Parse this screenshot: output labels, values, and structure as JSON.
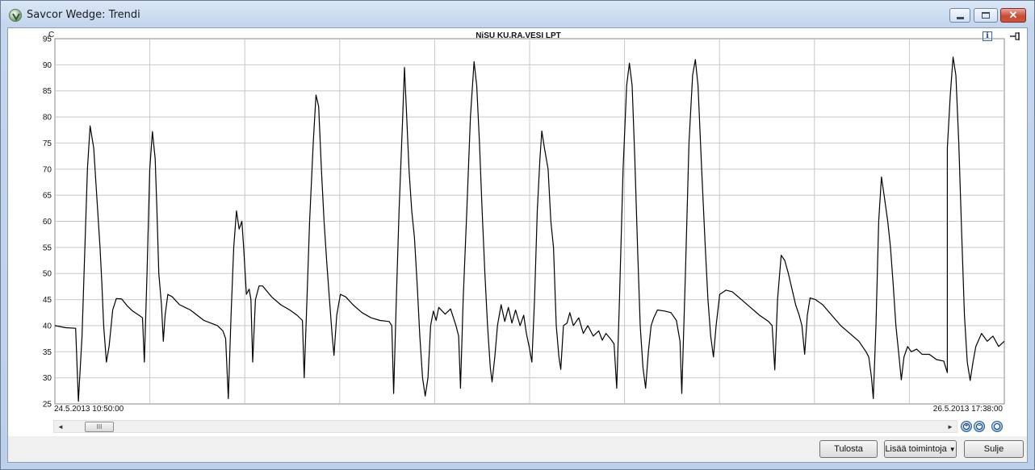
{
  "window": {
    "title": "Savcor Wedge: Trendi",
    "controls": {
      "minimize_icon": "minimize-icon",
      "maximize_icon": "maximize-icon",
      "close_icon": "close-icon"
    }
  },
  "chart_data": {
    "type": "line",
    "title": "NiSU KU.RA.VESI LPT",
    "ylabel": "C",
    "ylim": [
      25,
      95
    ],
    "yticks": [
      25,
      30,
      35,
      40,
      45,
      50,
      55,
      60,
      65,
      70,
      75,
      80,
      85,
      90,
      95
    ],
    "xlim": [
      0,
      100
    ],
    "grid": true,
    "x_start_label": "24.5.2013 10:50:00",
    "x_end_label": "26.5.2013 17:38:00",
    "series": [
      {
        "color": "#000000",
        "points": [
          [
            0,
            40
          ],
          [
            1.2,
            39.6
          ],
          [
            2.3,
            39.5
          ],
          [
            2.6,
            25.5
          ],
          [
            3,
            38
          ],
          [
            3.6,
            70
          ],
          [
            3.9,
            78.3
          ],
          [
            4.3,
            74
          ],
          [
            4.7,
            63
          ],
          [
            5,
            55
          ],
          [
            5.2,
            48
          ],
          [
            5.4,
            40
          ],
          [
            5.7,
            33
          ],
          [
            6,
            36
          ],
          [
            6.4,
            43
          ],
          [
            6.8,
            45.2
          ],
          [
            7.4,
            45.1
          ],
          [
            8,
            43.8
          ],
          [
            8.6,
            42.8
          ],
          [
            9.3,
            42
          ],
          [
            9.7,
            41.5
          ],
          [
            9.9,
            33
          ],
          [
            10.2,
            50
          ],
          [
            10.5,
            70
          ],
          [
            10.8,
            77.2
          ],
          [
            11.1,
            72
          ],
          [
            11.3,
            62
          ],
          [
            11.5,
            50
          ],
          [
            11.8,
            44
          ],
          [
            12,
            37
          ],
          [
            12.2,
            42
          ],
          [
            12.5,
            46
          ],
          [
            13,
            45.5
          ],
          [
            13.8,
            44
          ],
          [
            15,
            43
          ],
          [
            16.5,
            41
          ],
          [
            18,
            40
          ],
          [
            18.6,
            39
          ],
          [
            18.9,
            37.5
          ],
          [
            19.2,
            26
          ],
          [
            19.5,
            42
          ],
          [
            19.8,
            55
          ],
          [
            20.1,
            62
          ],
          [
            20.4,
            58.5
          ],
          [
            20.7,
            60
          ],
          [
            20.9,
            55
          ],
          [
            21.2,
            46
          ],
          [
            21.5,
            47
          ],
          [
            21.7,
            45
          ],
          [
            21.9,
            33
          ],
          [
            22.2,
            45
          ],
          [
            22.6,
            47.6
          ],
          [
            23,
            47.6
          ],
          [
            24,
            45.5
          ],
          [
            25,
            44
          ],
          [
            26,
            43
          ],
          [
            26.8,
            42
          ],
          [
            27.4,
            41
          ],
          [
            27.6,
            30
          ],
          [
            27.9,
            45
          ],
          [
            28.2,
            60
          ],
          [
            28.6,
            75
          ],
          [
            28.9,
            84.2
          ],
          [
            29.2,
            82
          ],
          [
            29.5,
            70
          ],
          [
            29.8,
            60
          ],
          [
            30.1,
            52
          ],
          [
            30.4,
            45
          ],
          [
            30.7,
            38
          ],
          [
            30.9,
            34.3
          ],
          [
            31.2,
            42
          ],
          [
            31.6,
            46
          ],
          [
            32.2,
            45.5
          ],
          [
            33,
            44
          ],
          [
            34,
            42.5
          ],
          [
            35,
            41.5
          ],
          [
            36,
            41
          ],
          [
            37,
            40.8
          ],
          [
            37.3,
            40
          ],
          [
            37.5,
            27
          ],
          [
            37.8,
            45
          ],
          [
            38.1,
            62
          ],
          [
            38.5,
            80
          ],
          [
            38.7,
            89.5
          ],
          [
            38.9,
            82
          ],
          [
            39.2,
            70
          ],
          [
            39.5,
            62
          ],
          [
            39.8,
            57
          ],
          [
            40.1,
            48
          ],
          [
            40.4,
            38
          ],
          [
            40.7,
            30
          ],
          [
            41,
            26.5
          ],
          [
            41.3,
            30
          ],
          [
            41.6,
            40
          ],
          [
            41.9,
            42.8
          ],
          [
            42.2,
            41
          ],
          [
            42.5,
            43.5
          ],
          [
            43.2,
            42.2
          ],
          [
            43.8,
            43.2
          ],
          [
            44.4,
            40
          ],
          [
            44.7,
            38
          ],
          [
            44.9,
            28
          ],
          [
            45.2,
            45
          ],
          [
            45.6,
            62
          ],
          [
            46,
            80
          ],
          [
            46.4,
            90.6
          ],
          [
            46.7,
            86
          ],
          [
            47,
            75
          ],
          [
            47.3,
            62
          ],
          [
            47.6,
            50
          ],
          [
            47.9,
            40
          ],
          [
            48.2,
            32
          ],
          [
            48.4,
            29.2
          ],
          [
            48.7,
            34
          ],
          [
            49,
            40
          ],
          [
            49.4,
            44
          ],
          [
            49.8,
            40.8
          ],
          [
            50.2,
            43.5
          ],
          [
            50.6,
            40.5
          ],
          [
            51,
            43
          ],
          [
            51.5,
            40
          ],
          [
            51.9,
            42
          ],
          [
            52.2,
            38.5
          ],
          [
            52.5,
            36
          ],
          [
            52.8,
            33
          ],
          [
            53.1,
            45
          ],
          [
            53.4,
            62
          ],
          [
            53.7,
            72
          ],
          [
            53.9,
            77.3
          ],
          [
            54.2,
            74
          ],
          [
            54.6,
            70
          ],
          [
            54.9,
            60
          ],
          [
            55.2,
            55
          ],
          [
            55.5,
            40
          ],
          [
            55.8,
            34
          ],
          [
            56,
            31.6
          ],
          [
            56.3,
            40
          ],
          [
            56.7,
            40.5
          ],
          [
            57,
            42.5
          ],
          [
            57.4,
            40
          ],
          [
            58,
            41.5
          ],
          [
            58.5,
            38.5
          ],
          [
            59,
            40
          ],
          [
            59.6,
            38
          ],
          [
            60.2,
            39
          ],
          [
            60.6,
            37.2
          ],
          [
            61,
            38.5
          ],
          [
            61.5,
            37.5
          ],
          [
            61.9,
            36.5
          ],
          [
            62.2,
            28
          ],
          [
            62.5,
            45
          ],
          [
            62.9,
            70
          ],
          [
            63.3,
            86
          ],
          [
            63.6,
            90.3
          ],
          [
            63.9,
            86
          ],
          [
            64.2,
            72
          ],
          [
            64.5,
            55
          ],
          [
            64.8,
            40
          ],
          [
            65.1,
            32
          ],
          [
            65.4,
            28
          ],
          [
            65.7,
            35
          ],
          [
            66,
            40
          ],
          [
            66.3,
            41.5
          ],
          [
            66.7,
            43
          ],
          [
            67.5,
            42.8
          ],
          [
            68.2,
            42.5
          ],
          [
            68.8,
            41
          ],
          [
            69.2,
            37
          ],
          [
            69.4,
            27
          ],
          [
            69.8,
            50
          ],
          [
            70.2,
            75
          ],
          [
            70.6,
            88
          ],
          [
            70.9,
            91
          ],
          [
            71.2,
            86
          ],
          [
            71.6,
            70
          ],
          [
            72,
            55
          ],
          [
            72.3,
            45
          ],
          [
            72.6,
            38
          ],
          [
            72.9,
            34
          ],
          [
            73.2,
            40
          ],
          [
            73.6,
            46
          ],
          [
            74.3,
            46.8
          ],
          [
            75,
            46.5
          ],
          [
            76,
            45
          ],
          [
            77,
            43.5
          ],
          [
            78,
            42
          ],
          [
            79,
            40.8
          ],
          [
            79.4,
            40
          ],
          [
            79.7,
            31.5
          ],
          [
            80,
            45
          ],
          [
            80.4,
            53.5
          ],
          [
            80.8,
            52.5
          ],
          [
            81.2,
            50
          ],
          [
            81.6,
            47
          ],
          [
            82,
            44
          ],
          [
            82.4,
            42
          ],
          [
            82.7,
            40
          ],
          [
            83,
            34.5
          ],
          [
            83.3,
            42
          ],
          [
            83.6,
            45.3
          ],
          [
            84.2,
            45
          ],
          [
            85,
            44
          ],
          [
            86,
            42
          ],
          [
            87,
            40
          ],
          [
            88,
            38.5
          ],
          [
            89,
            37
          ],
          [
            89.8,
            35
          ],
          [
            90.1,
            34
          ],
          [
            90.4,
            30
          ],
          [
            90.6,
            26
          ],
          [
            90.9,
            40
          ],
          [
            91.2,
            60
          ],
          [
            91.5,
            68.5
          ],
          [
            91.8,
            65
          ],
          [
            92.2,
            60
          ],
          [
            92.5,
            55
          ],
          [
            92.8,
            48
          ],
          [
            93.1,
            40
          ],
          [
            93.4,
            35
          ],
          [
            93.7,
            29.6
          ],
          [
            94,
            34
          ],
          [
            94.4,
            36
          ],
          [
            94.8,
            35
          ],
          [
            95.4,
            35.5
          ],
          [
            96,
            34.5
          ],
          [
            96.8,
            34.5
          ],
          [
            97.6,
            33.5
          ],
          [
            98.4,
            33.2
          ],
          [
            98.8,
            31
          ],
          [
            99.1,
            29.6
          ]
        ]
      },
      {
        "color": "#000000",
        "points": [
          [
            99.1,
            29.6
          ],
          [
            99.4,
            40
          ],
          [
            99.7,
            60
          ],
          [
            100,
            74
          ]
        ]
      }
    ]
  },
  "chart_extra": {
    "tail_points": [
      [
        0,
        74
      ],
      [
        1,
        84
      ],
      [
        2,
        91.5
      ],
      [
        3,
        88
      ],
      [
        4,
        75
      ],
      [
        5,
        58
      ],
      [
        6,
        42
      ],
      [
        7,
        33
      ],
      [
        8,
        29.5
      ],
      [
        9,
        33
      ],
      [
        10,
        36
      ],
      [
        12,
        38.5
      ],
      [
        14,
        37
      ],
      [
        16,
        38
      ],
      [
        18,
        36
      ],
      [
        20,
        37
      ]
    ]
  },
  "scrollbar": {
    "left_arrow": "◄",
    "right_arrow": "►",
    "thumb_grip": "III"
  },
  "zoom_controls": {
    "zoom_in_icon": "zoom-in-icon",
    "zoom_out_icon": "zoom-out-icon",
    "zoom_fit_icon": "zoom-fit-icon"
  },
  "toolbar_icons": {
    "info": "i",
    "pin_icon": "pin-icon"
  },
  "footer": {
    "print_label": "Tulosta",
    "more_actions_label": "Lisää toimintoja",
    "close_label": "Sulje"
  }
}
